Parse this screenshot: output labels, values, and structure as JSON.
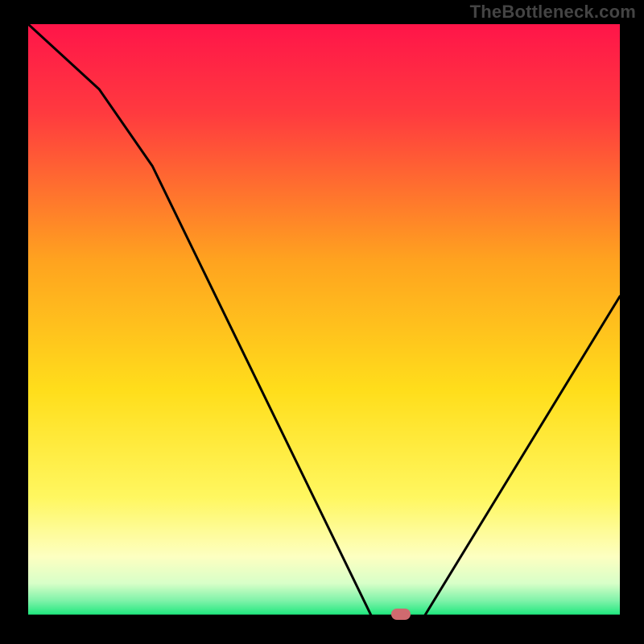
{
  "watermark": "TheBottleneck.com",
  "chart_data": {
    "type": "line",
    "title": "",
    "xlabel": "",
    "ylabel": "",
    "xlim": [
      0,
      100
    ],
    "ylim": [
      0,
      100
    ],
    "grid": false,
    "sweet_spot_marker": {
      "x": 63,
      "color": "#cf6a6f"
    },
    "series": [
      {
        "name": "bottleneck-curve",
        "x": [
          0,
          12,
          21,
          58,
          67,
          100
        ],
        "values": [
          100,
          89,
          76,
          0,
          0,
          54
        ]
      }
    ],
    "background_gradient": {
      "type": "vertical",
      "stops": [
        {
          "pos": 0.0,
          "color": "#ff1549"
        },
        {
          "pos": 0.15,
          "color": "#ff3a3f"
        },
        {
          "pos": 0.4,
          "color": "#ffa31f"
        },
        {
          "pos": 0.62,
          "color": "#ffde1b"
        },
        {
          "pos": 0.8,
          "color": "#fff760"
        },
        {
          "pos": 0.9,
          "color": "#fdffc1"
        },
        {
          "pos": 0.945,
          "color": "#d8ffc8"
        },
        {
          "pos": 0.975,
          "color": "#7df2a8"
        },
        {
          "pos": 1.0,
          "color": "#17e77a"
        }
      ]
    }
  }
}
